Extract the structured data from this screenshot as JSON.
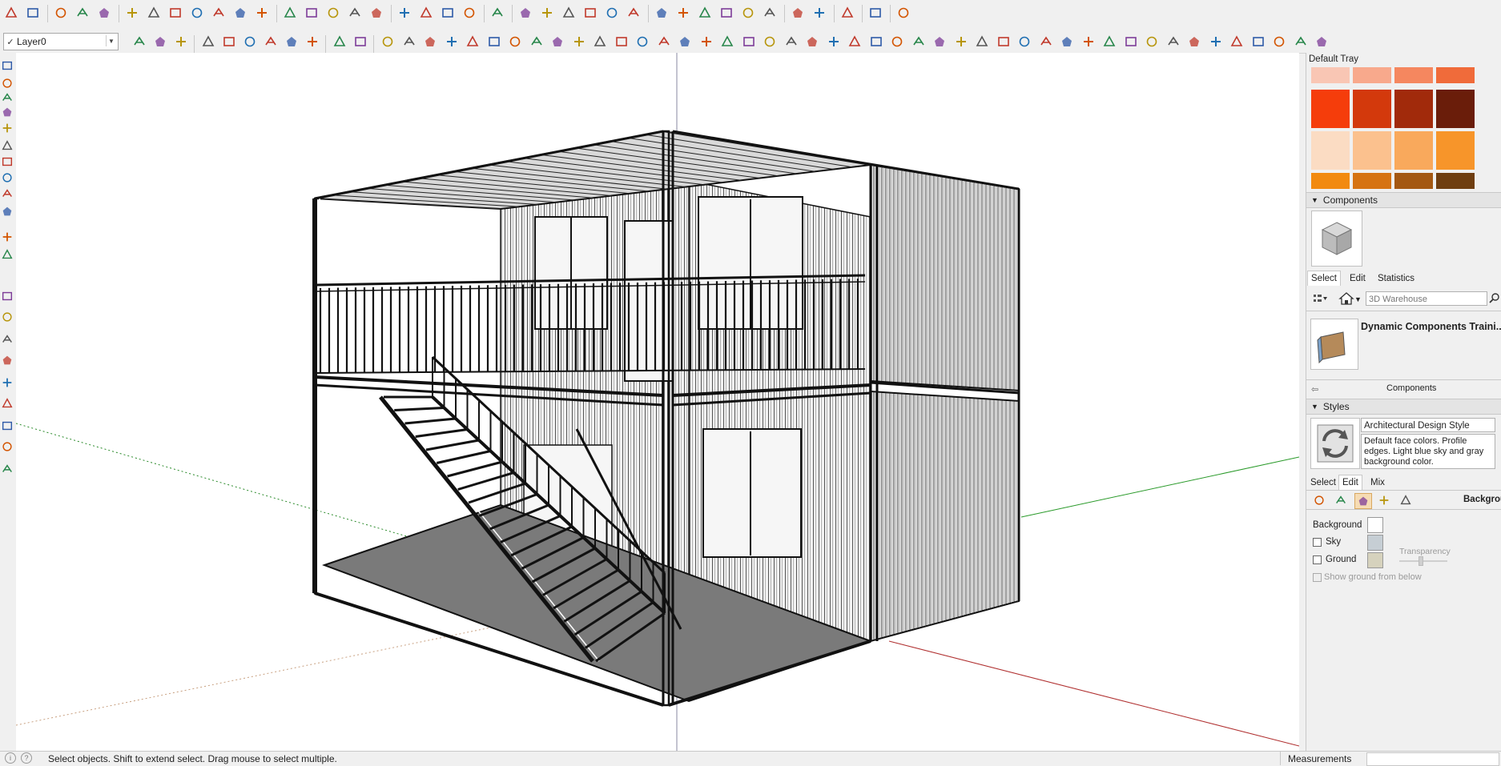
{
  "toolbar_main": {
    "icons": [
      "select-tool-icon",
      "eraser-icon",
      "pencil-line-icon",
      "freehand-arc-icon",
      "paint-bucket-icon",
      "push-pull-icon",
      "follow-me-icon",
      "move-icon",
      "rotate-icon",
      "scale-icon",
      "tape-measure-icon",
      "text-label-icon",
      "paint-brush-icon",
      "orbit-icon",
      "pan-icon",
      "zoom-icon",
      "zoom-extents-icon",
      "warehouse-icon",
      "share-model-icon",
      "extension-icon",
      "ruby-icon",
      "user-account-icon",
      "view-iso-icon",
      "view-top-icon",
      "view-front-icon",
      "view-right-icon",
      "view-back-icon",
      "view-left-icon",
      "xray-icon",
      "wireframe-icon",
      "hidden-line-icon",
      "shaded-icon",
      "textured-icon",
      "monochrome-icon",
      "section-plane-icon",
      "sandbox-icon",
      "color-palette-icon",
      "layout-icon",
      "stairs-plugin-icon"
    ]
  },
  "toolbar_secondary": {
    "layer_current": "Layer0",
    "layer_check": "✓"
  },
  "left_toolbar_icons": [
    "walk-icon",
    "look-around-icon",
    "position-camera-icon",
    "section-icon",
    "axes-icon",
    "tree-plugin-icon",
    "sun-shadow-icon",
    "checker-pattern-icon",
    "house-plugin-icon",
    "settings-gears-icon",
    "mail-icon",
    "info-icon",
    "blue-cube-icon",
    "blue-plane-icon",
    "blue-arrow-icon",
    "red-arrow-icon",
    "pipe-icon",
    "image-igloo-icon",
    "red-u-icon",
    "red-hook-icon",
    "rainbow-icon"
  ],
  "tray": {
    "title": "Default Tray",
    "swatch_colors": [
      "#f9c6b4",
      "#f8a98c",
      "#f5875f",
      "#f06b3a",
      "#f53d0b",
      "#d3390c",
      "#a12a0b",
      "#6a1d0a",
      "#fbdcc3",
      "#fbc18e",
      "#f9a95c",
      "#f7952a",
      "#f28a10",
      "#d67312",
      "#a45812",
      "#6f3e10"
    ],
    "components": {
      "header": "Components",
      "tabs": [
        "Select",
        "Edit",
        "Statistics"
      ],
      "search_placeholder": "3D Warehouse",
      "collection_title": "Dynamic Components Traini...",
      "footer_label": "Components"
    },
    "styles": {
      "header": "Styles",
      "style_name": "Architectural Design Style",
      "style_desc": "Default face colors. Profile edges. Light blue sky and gray background color.",
      "tabs": [
        "Select",
        "Edit",
        "Mix"
      ],
      "section_label": "Backgrou",
      "background_label": "Background",
      "sky_label": "Sky",
      "ground_label": "Ground",
      "transparency_label": "Transparency",
      "show_ground_label": "Show ground from below",
      "background_color": "#ffffff",
      "sky_color": "#c6ced4",
      "ground_color": "#d6d2bd"
    }
  },
  "status": {
    "message": "Select objects. Shift to extend select. Drag mouse to select multiple.",
    "measurements_label": "Measurements"
  }
}
